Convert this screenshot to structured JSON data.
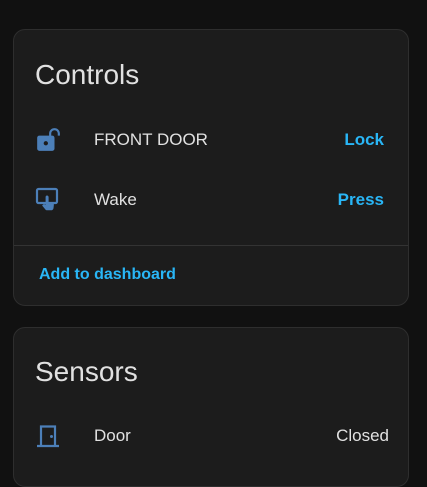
{
  "accent_color": "#29b6f6",
  "icon_color": "#4c7fb8",
  "controls": {
    "title": "Controls",
    "items": [
      {
        "icon": "lock-open-icon",
        "label": "FRONT DOOR",
        "action": "Lock"
      },
      {
        "icon": "gesture-tap-icon",
        "label": "Wake",
        "action": "Press"
      }
    ],
    "footer_link": "Add to dashboard"
  },
  "sensors": {
    "title": "Sensors",
    "items": [
      {
        "icon": "door-icon",
        "label": "Door",
        "state": "Closed"
      }
    ]
  }
}
